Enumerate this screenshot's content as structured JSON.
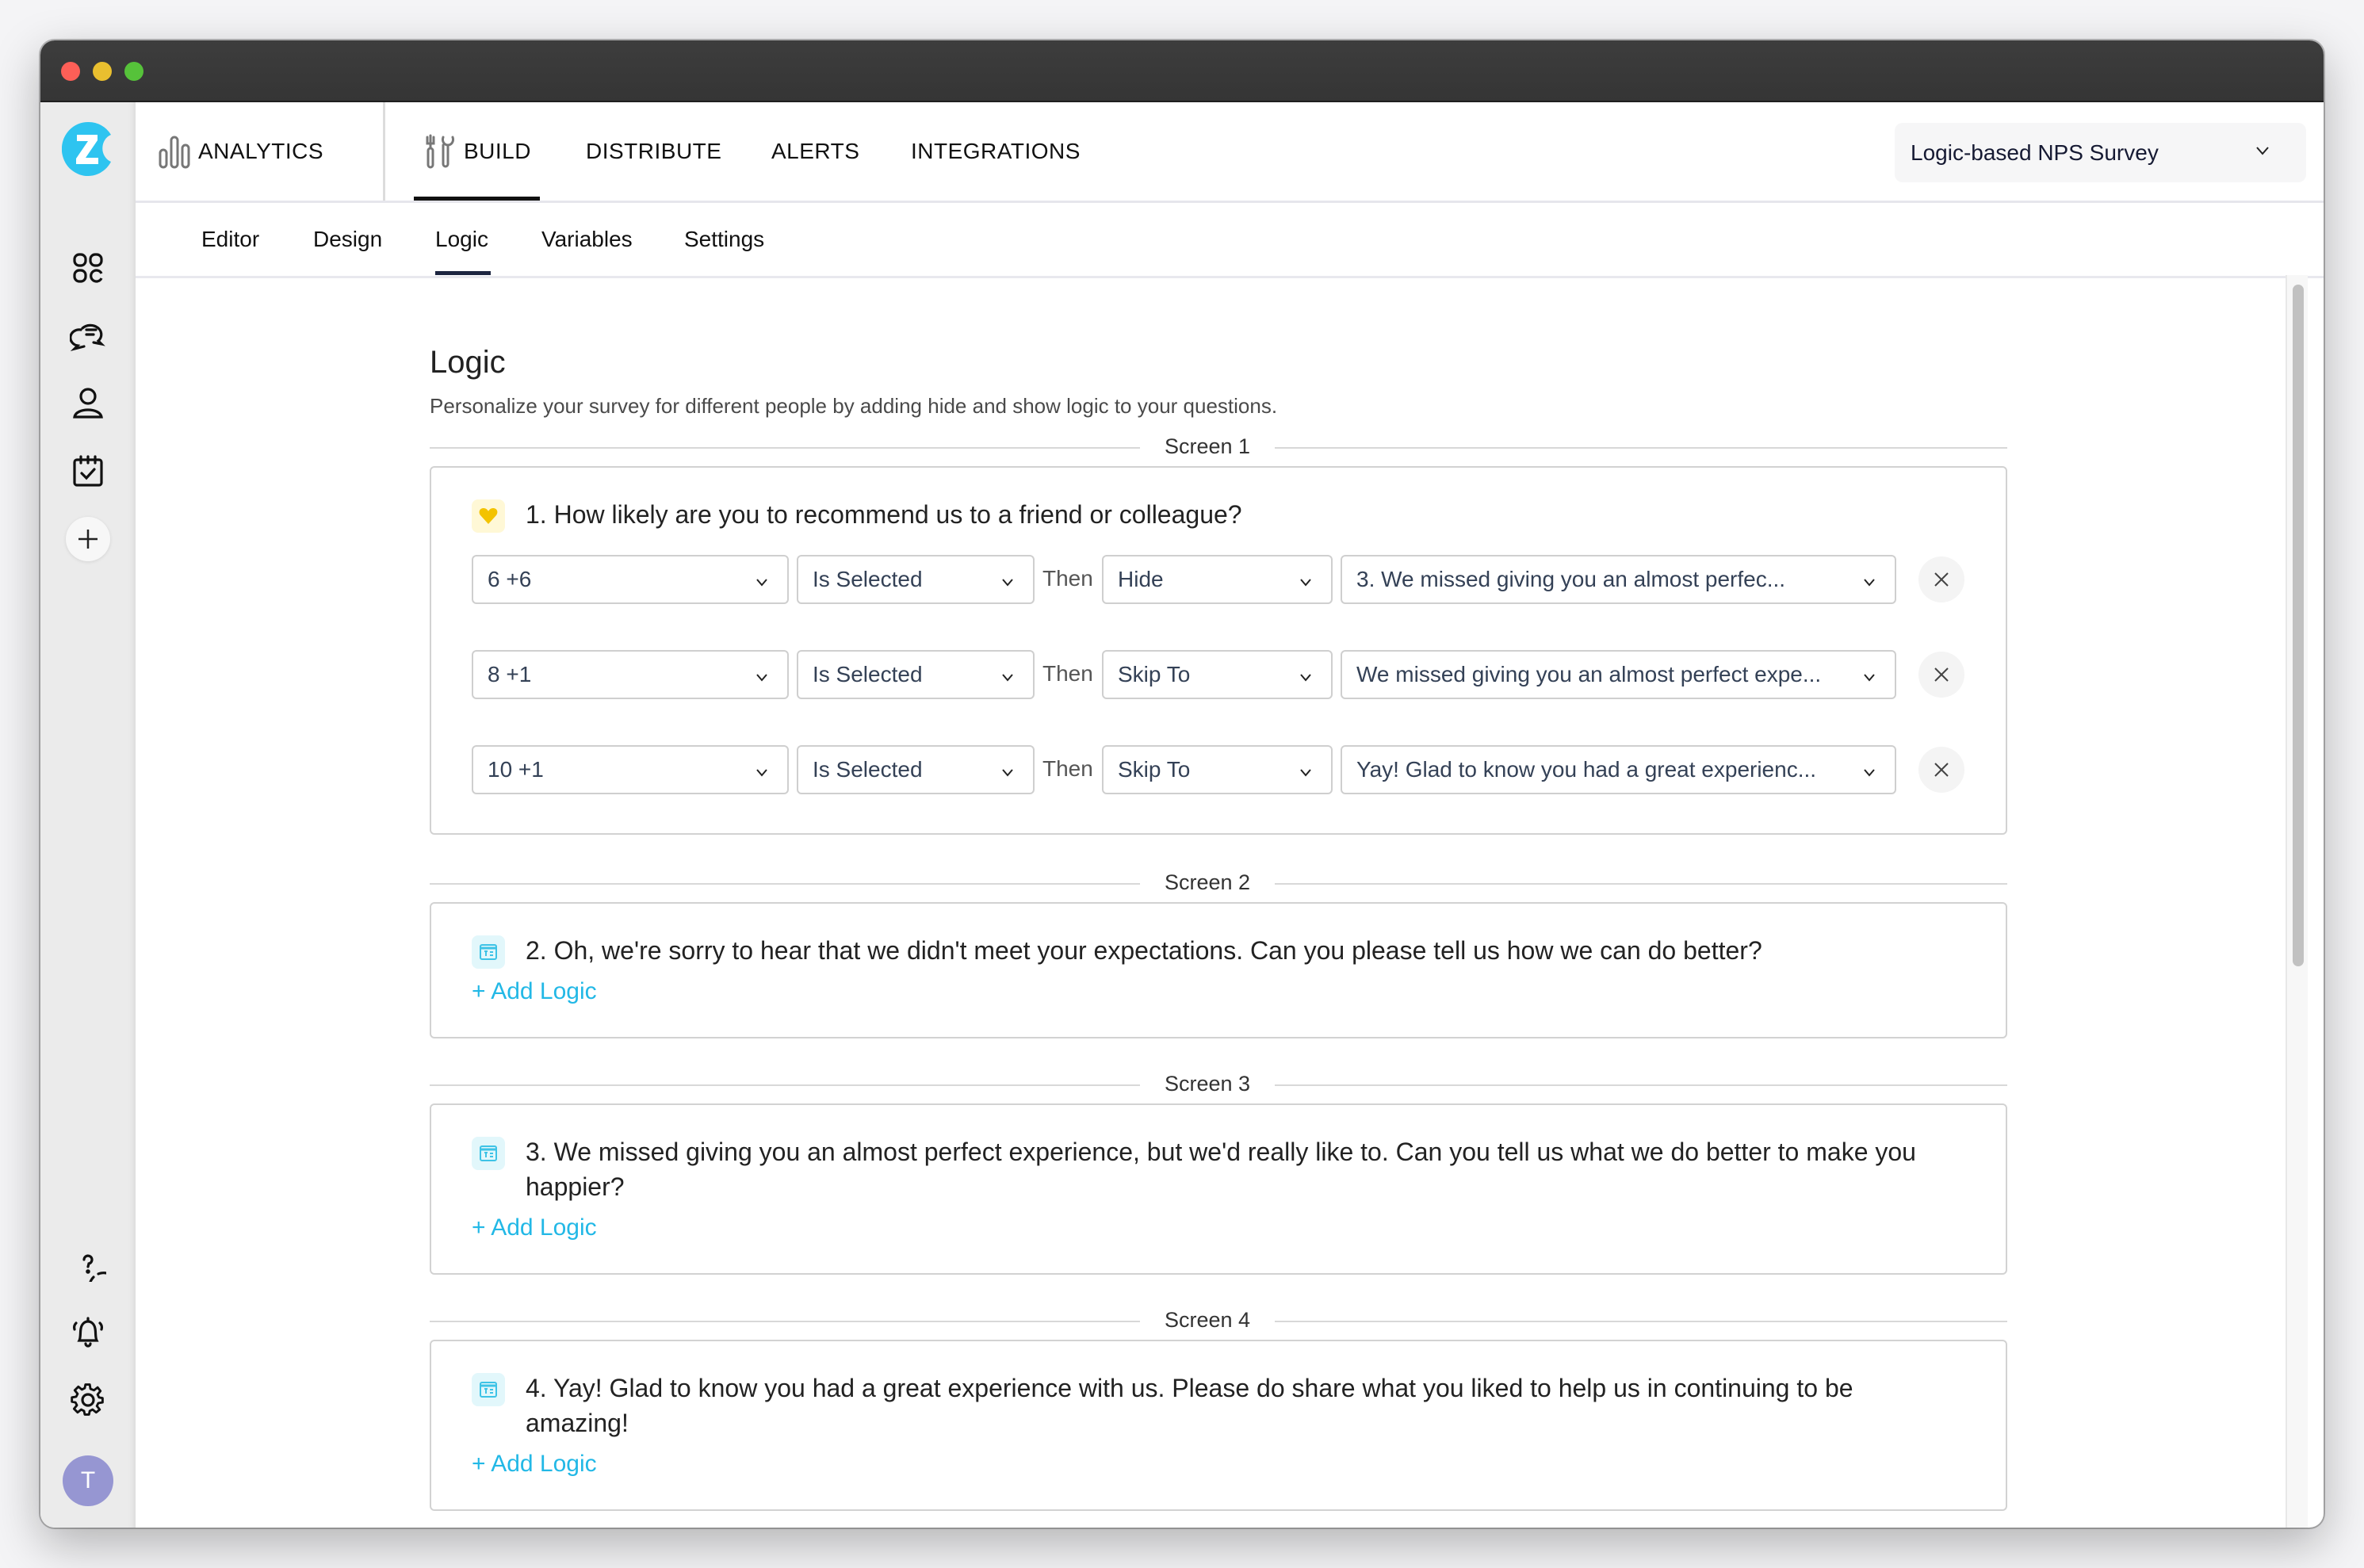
{
  "app": {
    "brand_color": "#2ec4f0",
    "accent_link_color": "#22b8e6",
    "avatar_initial": "T",
    "avatar_color": "#9696d2"
  },
  "sidebar": {
    "top_items": [
      {
        "name": "dashboard",
        "icon": "grid-icon"
      },
      {
        "name": "feedback",
        "icon": "chat-bubbles-icon"
      },
      {
        "name": "contacts",
        "icon": "user-icon"
      },
      {
        "name": "tasks",
        "icon": "calendar-check-icon"
      }
    ],
    "add_icon": "plus-icon",
    "bottom_items": [
      {
        "name": "help",
        "icon": "help-circle-icon"
      },
      {
        "name": "notifications",
        "icon": "bell-icon"
      },
      {
        "name": "settings",
        "icon": "gear-icon"
      }
    ]
  },
  "topnav": {
    "items": [
      {
        "label": "ANALYTICS",
        "icon": "bar-chart-icon",
        "active": false
      },
      {
        "label": "BUILD",
        "icon": "tools-icon",
        "active": true
      },
      {
        "label": "DISTRIBUTE",
        "active": false
      },
      {
        "label": "ALERTS",
        "active": false
      },
      {
        "label": "INTEGRATIONS",
        "active": false
      }
    ],
    "survey_selector": {
      "value": "Logic-based NPS Survey"
    }
  },
  "subnav": {
    "items": [
      {
        "label": "Editor",
        "active": false
      },
      {
        "label": "Design",
        "active": false
      },
      {
        "label": "Logic",
        "active": true
      },
      {
        "label": "Variables",
        "active": false
      },
      {
        "label": "Settings",
        "active": false
      }
    ]
  },
  "main": {
    "title": "Logic",
    "description": "Personalize your survey for different people by adding hide and show logic to your questions.",
    "then_label": "Then",
    "add_logic_label": "+ Add Logic",
    "screens": [
      {
        "label": "Screen 1",
        "question": "1. How likely are you to recommend us to a friend or colleague?",
        "question_icon": "heart-icon",
        "rules": [
          {
            "choice": "6 +6",
            "condition": "Is Selected",
            "action": "Hide",
            "target": "3. We missed giving you an almost perfec..."
          },
          {
            "choice": "8 +1",
            "condition": "Is Selected",
            "action": "Skip To",
            "target": "We missed giving you an almost perfect expe..."
          },
          {
            "choice": "10 +1",
            "condition": "Is Selected",
            "action": "Skip To",
            "target": "Yay! Glad to know you had a great experienc..."
          }
        ]
      },
      {
        "label": "Screen 2",
        "question": "2. Oh, we're sorry to hear that we didn't meet your expectations. Can you please tell us how we can do better?",
        "question_icon": "text-input-icon"
      },
      {
        "label": "Screen 3",
        "question": "3. We missed giving you an almost perfect experience, but we'd really like to. Can you tell us what we do better to make you happier?",
        "question_icon": "text-input-icon"
      },
      {
        "label": "Screen 4",
        "question": "4. Yay! Glad to know you had a great experience with us. Please do share what you liked to help us in continuing to be amazing!",
        "question_icon": "text-input-icon"
      }
    ]
  }
}
